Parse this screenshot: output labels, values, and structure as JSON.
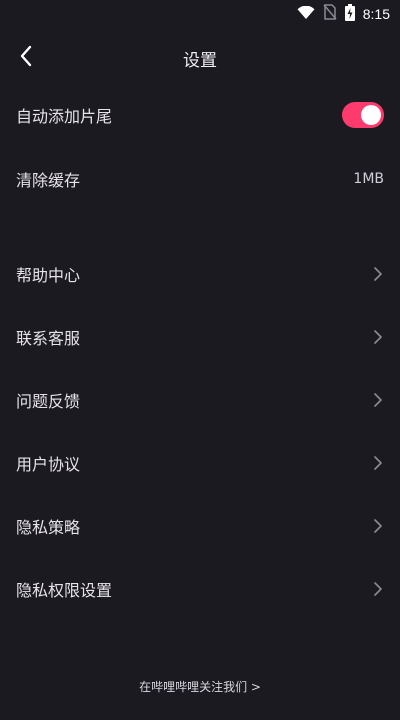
{
  "status_bar": {
    "time": "8:15",
    "icons": [
      "wifi-icon",
      "no-sim-icon",
      "battery-charging-icon"
    ]
  },
  "header": {
    "back_icon": "back-arrow-icon",
    "title": "设置"
  },
  "settings": {
    "auto_add_ending": {
      "label": "自动添加片尾",
      "enabled": true,
      "accent_color": "#ff3a6c"
    },
    "clear_cache": {
      "label": "清除缓存",
      "value": "1MB"
    },
    "items": [
      {
        "label": "帮助中心"
      },
      {
        "label": "联系客服"
      },
      {
        "label": "问题反馈"
      },
      {
        "label": "用户协议"
      },
      {
        "label": "隐私策略"
      },
      {
        "label": "隐私权限设置"
      }
    ]
  },
  "footer": {
    "link": "在哔哩哔哩关注我们 >"
  }
}
